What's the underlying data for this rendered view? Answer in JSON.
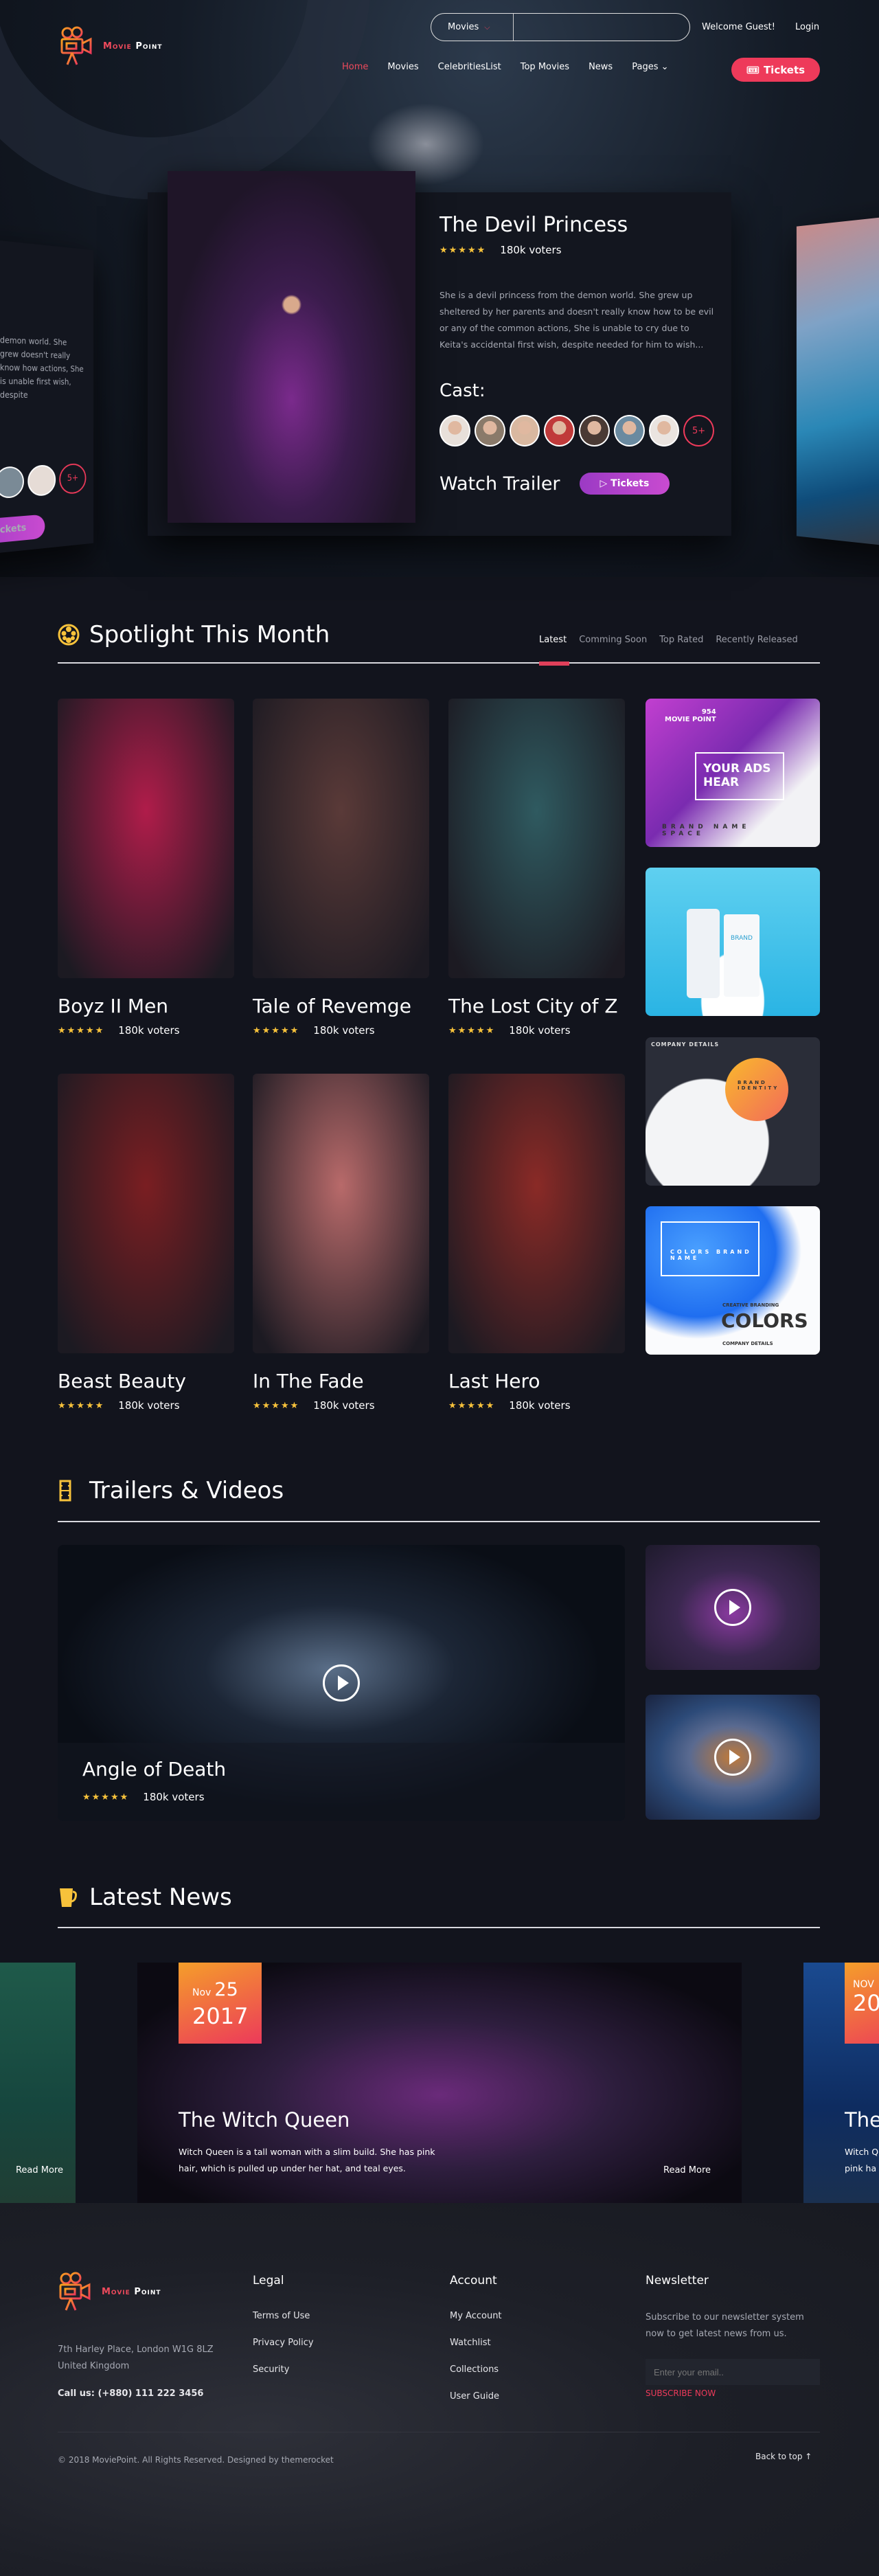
{
  "header": {
    "logo": {
      "word1": "Movie",
      "word2": "Point"
    },
    "search": {
      "category": "Movies",
      "placeholder": ""
    },
    "welcome": "Welcome Guest!",
    "login": "Login",
    "nav": [
      {
        "label": "Home",
        "active": true
      },
      {
        "label": "Movies"
      },
      {
        "label": "CelebritiesList"
      },
      {
        "label": "Top Movies"
      },
      {
        "label": "News"
      },
      {
        "label": "Pages ⌄"
      }
    ],
    "tickets_label": "Tickets"
  },
  "hero": {
    "title": "The Devil Princess",
    "stars": "★★★★★",
    "voters": "180k voters",
    "description": "She is a devil princess from the demon world. She grew up sheltered by her parents and doesn't really know how to be evil or any of the common actions, She is unable to cry due to Keita's accidental first wish, despite needed for him to wish...",
    "side_description": "demon world. She grew doesn't really know how actions, She is unable first wish, despite",
    "cast_label": "Cast:",
    "cast_more": "5+",
    "cast_count": 7,
    "watch_trailer": "Watch Trailer",
    "tickets_label": "Tickets"
  },
  "spotlight": {
    "title": "Spotlight This Month",
    "tabs": [
      {
        "label": "Latest",
        "active": true
      },
      {
        "label": "Comming Soon"
      },
      {
        "label": "Top Rated"
      },
      {
        "label": "Recently Released"
      }
    ],
    "movies": [
      {
        "title": "Boyz II Men",
        "stars": "★★★★★",
        "voters": "180k voters",
        "color": "#b01c4a"
      },
      {
        "title": "Tale of Revemge",
        "stars": "★★★★★",
        "voters": "180k voters",
        "color": "#5a3a38"
      },
      {
        "title": "The Lost City of Z",
        "stars": "★★★★★",
        "voters": "180k voters",
        "color": "#2f5a60"
      },
      {
        "title": "Beast Beauty",
        "stars": "★★★★★",
        "voters": "180k voters",
        "color": "#7a1e22"
      },
      {
        "title": "In The Fade",
        "stars": "★★★★★",
        "voters": "180k voters",
        "color": "#b86a6a"
      },
      {
        "title": "Last Hero",
        "stars": "★★★★★",
        "voters": "180k voters",
        "color": "#8a2a26"
      }
    ],
    "ads": [
      {
        "line1": "954",
        "line2": "MOVIE POINT",
        "line3": "YOUR ADS HEAR",
        "line4": "BRAND NAME SPACE"
      },
      {
        "line1": "BRAND"
      },
      {
        "line1": "COMPANY DETAILS",
        "line2": "BRAND IDENTITY"
      },
      {
        "line1": "COLORS BRAND NAME",
        "line2": "CREATIVE BRANDING",
        "line3": "COLORS",
        "line4": "COMPANY DETAILS"
      }
    ]
  },
  "trailers": {
    "title": "Trailers & Videos",
    "main": {
      "title": "Angle of Death",
      "stars": "★★★★★",
      "voters": "180k voters"
    }
  },
  "news": {
    "title": "Latest News",
    "item": {
      "month": "Nov",
      "day": "25",
      "year": "2017",
      "title": "The Witch Queen",
      "text": "Witch Queen is a tall woman with a slim build. She has pink hair, which is pulled up under her hat, and teal eyes.",
      "read_more": "Read More"
    },
    "left_read_more": "Read More",
    "right": {
      "month": "NOV",
      "year": "20",
      "title": "The",
      "text1": "Witch Q",
      "text2": "pink ha"
    }
  },
  "footer": {
    "address1": "7th Harley Place, London W1G 8LZ",
    "address2": "United Kingdom",
    "phone": "Call us: (+880) 111 222 3456",
    "legal": {
      "title": "Legal",
      "links": [
        "Terms of Use",
        "Privacy Policy",
        "Security"
      ]
    },
    "account": {
      "title": "Account",
      "links": [
        "My Account",
        "Watchlist",
        "Collections",
        "User Guide"
      ]
    },
    "newsletter": {
      "title": "Newsletter",
      "text": "Subscribe to our newsletter system now to get latest news from us.",
      "placeholder": "Enter your email..",
      "subscribe": "SUBSCRIBE NOW"
    },
    "copyright": "© 2018 MoviePoint. All Rights Reserved. Designed by themerocket",
    "back_to_top": "Back to top ↑"
  },
  "colors": {
    "accent": "#ee3a5a",
    "star": "#f7c23b",
    "purple": "#b042c8",
    "bg": "#12141d"
  }
}
